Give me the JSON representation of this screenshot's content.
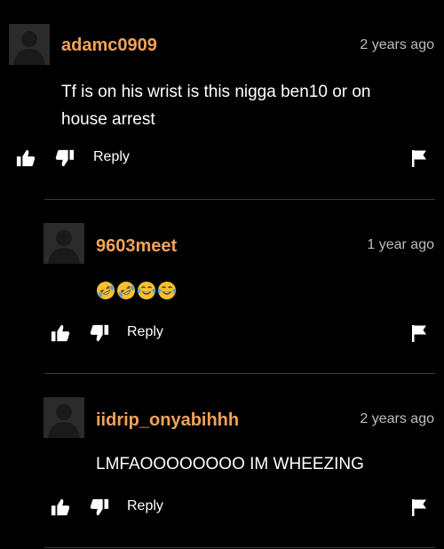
{
  "comments": [
    {
      "username": "adamc0909",
      "time": "2 years ago",
      "text": "Tf is on his wrist is this nigga ben10 or on house arrest",
      "reply_label": "Reply"
    },
    {
      "username": "9603meet",
      "time": "1 year ago",
      "emojis": [
        "rolling-on-floor-laughing",
        "rolling-on-floor-laughing",
        "tears-of-joy",
        "tears-of-joy"
      ],
      "reply_label": "Reply"
    },
    {
      "username": "iidrip_onyabihhh",
      "time": "2 years ago",
      "text": "LMFAOOOOOOOO IM WHEEZING",
      "reply_label": "Reply"
    }
  ],
  "colors": {
    "background": "#000000",
    "username": "#f0a35a",
    "timestamp": "#bdbdbd",
    "divider": "#3a3a3a"
  }
}
